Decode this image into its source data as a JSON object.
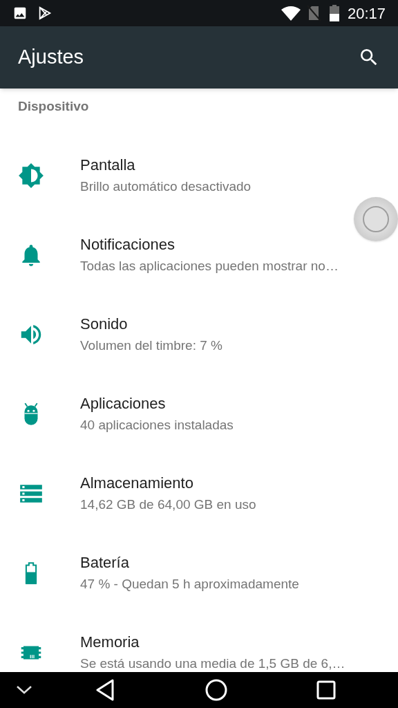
{
  "status_bar": {
    "time": "20:17"
  },
  "toolbar": {
    "title": "Ajustes"
  },
  "section": {
    "title": "Dispositivo"
  },
  "items": [
    {
      "kind": "display",
      "title": "Pantalla",
      "summary": "Brillo automático desactivado"
    },
    {
      "kind": "notifications",
      "title": "Notificaciones",
      "summary": "Todas las aplicaciones pueden mostrar no…"
    },
    {
      "kind": "sound",
      "title": "Sonido",
      "summary": "Volumen del timbre: 7 %"
    },
    {
      "kind": "apps",
      "title": "Aplicaciones",
      "summary": "40 aplicaciones instaladas"
    },
    {
      "kind": "storage",
      "title": "Almacenamiento",
      "summary": "14,62 GB de 64,00 GB en uso"
    },
    {
      "kind": "battery",
      "title": "Batería",
      "summary": "47 % - Quedan 5 h aproximadamente"
    },
    {
      "kind": "memory",
      "title": "Memoria",
      "summary": "Se está usando una media de 1,5 GB de 6,…"
    }
  ]
}
